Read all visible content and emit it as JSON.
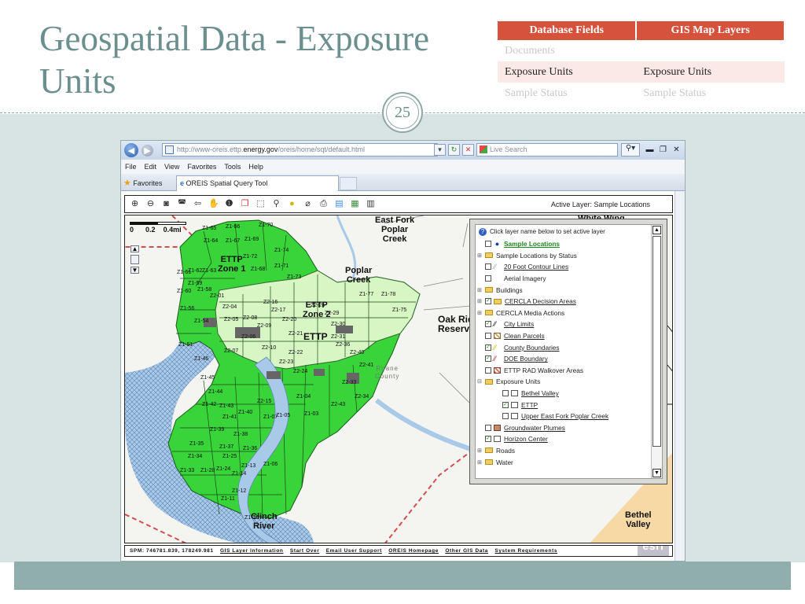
{
  "slide": {
    "title": "Geospatial Data - Exposure Units",
    "number": "25"
  },
  "legend_table": {
    "headers": [
      "Database Fields",
      "GIS Map Layers"
    ],
    "rows": [
      [
        "Documents",
        ""
      ],
      [
        "Exposure Units",
        "Exposure Units"
      ],
      [
        "Sample Status",
        "Sample Status"
      ]
    ],
    "highlight_row": 1,
    "header_color": "#d5533c"
  },
  "browser": {
    "url_prefix": "http://www-oreis.ettp.",
    "url_domain": "energy.gov",
    "url_path": "/oreis/home/sqt/default.html",
    "search_placeholder": "Live Search",
    "menu": [
      "File",
      "Edit",
      "View",
      "Favorites",
      "Tools",
      "Help"
    ],
    "favorites_label": "Favorites",
    "tab_title": "OREIS Spatial Query Tool"
  },
  "app": {
    "active_layer": "Active Layer: Sample Locations",
    "scale": [
      "0",
      "0.2",
      "0.4mi"
    ],
    "map_labels": {
      "east_fork": "East Fork\nPoplar\nCreek",
      "poplar_creek": "Poplar\nCreek",
      "ettp_zone1": "ETTP\nZone 1",
      "ettp_zone2": "ETTP\nZone 2",
      "ettp": "ETTP",
      "oak_ridge": "Oak Rid\nReservat",
      "white_wing": "White Wing",
      "clinch_river": "Clinch\nRiver",
      "bethel_valley": "Bethel\nValley",
      "roane_county": "Roane\nCounty"
    },
    "unit_labels": [
      "Z1-65",
      "Z1-66",
      "Z1-70",
      "Z1-64",
      "Z1-67",
      "Z1-69",
      "Z1-72",
      "Z1-74",
      "Z1-68",
      "Z1-71",
      "Z1-73",
      "Z1-61",
      "Z1-62",
      "Z1-63",
      "Z1-59",
      "Z1-58",
      "Z1-60",
      "Z2-01",
      "Z2-04",
      "Z2-05",
      "Z2-06",
      "Z2-07",
      "Z2-08",
      "Z2-09",
      "Z2-10",
      "Z2-16",
      "Z2-17",
      "Z2-20",
      "Z2-21",
      "Z2-22",
      "Z2-24",
      "Z2-26",
      "Z2-29",
      "Z2-30",
      "Z2-31",
      "Z2-36",
      "Z2-40",
      "Z2-41",
      "Z1-77",
      "Z1-78",
      "Z1-75",
      "Z1-56",
      "Z1-54",
      "Z1-51",
      "Z1-46",
      "Z1-45",
      "Z1-44",
      "Z1-42",
      "Z1-43",
      "Z1-40",
      "Z1-41",
      "Z1-39",
      "Z1-38",
      "Z1-37",
      "Z1-36",
      "Z1-35",
      "Z1-34",
      "Z1-33",
      "Z1-28",
      "Z1-25",
      "Z1-24",
      "Z1-14",
      "Z1-13",
      "Z1-12",
      "Z1-11",
      "Z1-10",
      "Z1-06",
      "Z1-07",
      "Z1-05",
      "Z1-04",
      "Z1-03",
      "Z2-15",
      "Z2-23",
      "Z2-33",
      "Z2-34",
      "Z2-43"
    ],
    "layer_panel": {
      "header": "Click layer name below to set active layer",
      "layers": [
        {
          "label": "Sample Locations",
          "expander": "",
          "checked": false,
          "swatch": "dot",
          "underline": true,
          "active": true,
          "indent": 0
        },
        {
          "label": "Sample Locations by Status",
          "expander": "+",
          "checked": null,
          "swatch": "folder",
          "underline": false,
          "active": false,
          "indent": 0
        },
        {
          "label": "20 Foot Contour Lines",
          "expander": "",
          "checked": false,
          "swatch": "line-gray",
          "underline": true,
          "active": false,
          "indent": 0
        },
        {
          "label": "Aerial Imagery",
          "expander": "",
          "checked": false,
          "swatch": "none",
          "underline": false,
          "active": false,
          "indent": 0
        },
        {
          "label": "Buildings",
          "expander": "+",
          "checked": null,
          "swatch": "folder",
          "underline": false,
          "active": false,
          "indent": 0
        },
        {
          "label": "CERCLA Decision Areas",
          "expander": "+",
          "checked": true,
          "swatch": "folder",
          "underline": true,
          "active": false,
          "indent": 0
        },
        {
          "label": "CERCLA Media Actions",
          "expander": "+",
          "checked": null,
          "swatch": "folder",
          "underline": false,
          "active": false,
          "indent": 0
        },
        {
          "label": "City Limits",
          "expander": "",
          "checked": true,
          "swatch": "line-black",
          "underline": true,
          "active": false,
          "indent": 0
        },
        {
          "label": "Clean Parcels",
          "expander": "",
          "checked": false,
          "swatch": "hatch-brown",
          "underline": true,
          "active": false,
          "indent": 0
        },
        {
          "label": "County Boundaries",
          "expander": "",
          "checked": true,
          "swatch": "line-yellow",
          "underline": true,
          "active": false,
          "indent": 0
        },
        {
          "label": "DOE Boundary",
          "expander": "",
          "checked": true,
          "swatch": "line-red",
          "underline": true,
          "active": false,
          "indent": 0
        },
        {
          "label": "ETTP RAD Walkover Areas",
          "expander": "",
          "checked": false,
          "swatch": "hatch-red",
          "underline": false,
          "active": false,
          "indent": 0
        },
        {
          "label": "Exposure Units",
          "expander": "-",
          "checked": null,
          "swatch": "folder",
          "underline": false,
          "active": false,
          "indent": 0
        },
        {
          "label": "Bethel Valley",
          "expander": "",
          "checked": false,
          "swatch": "box-white",
          "underline": true,
          "active": false,
          "indent": 1
        },
        {
          "label": "ETTP",
          "expander": "",
          "checked": true,
          "swatch": "box-white",
          "underline": true,
          "active": false,
          "indent": 1
        },
        {
          "label": "Upper East Fork Poplar Creek",
          "expander": "",
          "checked": false,
          "swatch": "box-white",
          "underline": true,
          "active": false,
          "indent": 1
        },
        {
          "label": "Groundwater Plumes",
          "expander": "",
          "checked": false,
          "swatch": "box-brown",
          "underline": true,
          "active": false,
          "indent": 0
        },
        {
          "label": "Horizon Center",
          "expander": "",
          "checked": true,
          "swatch": "box-white",
          "underline": true,
          "active": false,
          "indent": 0
        },
        {
          "label": "Roads",
          "expander": "+",
          "checked": null,
          "swatch": "folder",
          "underline": false,
          "active": false,
          "indent": 0
        },
        {
          "label": "Water",
          "expander": "+",
          "checked": null,
          "swatch": "folder",
          "underline": false,
          "active": false,
          "indent": 0
        }
      ]
    },
    "status": {
      "coords": "SPM: 746781.839, 178249.981",
      "links": [
        "GIS Layer Information",
        "Start Over",
        "Email User Support",
        "OREIS Homepage",
        "Other GIS Data",
        "System Requirements"
      ]
    },
    "colors": {
      "exposure_unit_green": "#39d33a",
      "zone2_light_green": "#d8f5c4",
      "river_blue": "#a9c9e8",
      "doe_boundary_red": "#d05050",
      "bethel_valley_tan": "#f6d9a4"
    }
  }
}
